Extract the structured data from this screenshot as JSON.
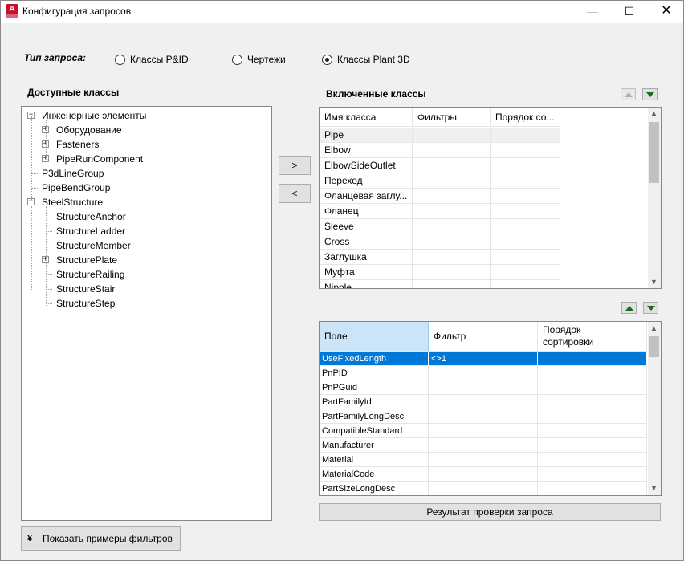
{
  "window": {
    "title": "Конфигурация запросов"
  },
  "query_type": {
    "label": "Тип запроса:",
    "options": [
      {
        "label": "Классы P&ID",
        "selected": false
      },
      {
        "label": "Чертежи",
        "selected": false
      },
      {
        "label": "Классы Plant 3D",
        "selected": true
      }
    ]
  },
  "available": {
    "label": "Доступные классы",
    "tree": [
      {
        "label": "Инженерные элементы",
        "expander": "-"
      },
      {
        "label": "Оборудование",
        "expander": "+"
      },
      {
        "label": "Fasteners",
        "expander": "+"
      },
      {
        "label": "PipeRunComponent",
        "expander": "+"
      },
      {
        "label": "P3dLineGroup",
        "expander": ""
      },
      {
        "label": "PipeBendGroup",
        "expander": ""
      },
      {
        "label": "SteelStructure",
        "expander": "-"
      },
      {
        "label": "StructureAnchor",
        "expander": ""
      },
      {
        "label": "StructureLadder",
        "expander": ""
      },
      {
        "label": "StructureMember",
        "expander": ""
      },
      {
        "label": "StructurePlate",
        "expander": "+"
      },
      {
        "label": "StructureRailing",
        "expander": ""
      },
      {
        "label": "StructureStair",
        "expander": ""
      },
      {
        "label": "StructureStep",
        "expander": ""
      }
    ]
  },
  "move": {
    "add_label": ">",
    "remove_label": "<"
  },
  "included": {
    "label": "Включенные классы",
    "columns": [
      "Имя класса",
      "Фильтры",
      "Порядок со..."
    ],
    "rows": [
      "Pipe",
      "Elbow",
      "ElbowSideOutlet",
      "Переход",
      "Фланцевая заглу...",
      "Фланец",
      "Sleeve",
      "Cross",
      "Заглушка",
      "Муфта",
      "Nipple"
    ]
  },
  "properties": {
    "columns": [
      "Поле",
      "Фильтр",
      "Порядок сортировки"
    ],
    "rows": [
      {
        "field": "UseFixedLength",
        "filter": "<>1",
        "order": ""
      },
      {
        "field": "PnPID",
        "filter": "",
        "order": ""
      },
      {
        "field": "PnPGuid",
        "filter": "",
        "order": ""
      },
      {
        "field": "PartFamilyId",
        "filter": "",
        "order": ""
      },
      {
        "field": "PartFamilyLongDesc",
        "filter": "",
        "order": ""
      },
      {
        "field": "CompatibleStandard",
        "filter": "",
        "order": ""
      },
      {
        "field": "Manufacturer",
        "filter": "",
        "order": ""
      },
      {
        "field": "Material",
        "filter": "",
        "order": ""
      },
      {
        "field": "MaterialCode",
        "filter": "",
        "order": ""
      },
      {
        "field": "PartSizeLongDesc",
        "filter": "",
        "order": ""
      }
    ]
  },
  "test_button": {
    "label": "Результат проверки запроса"
  },
  "examples_button": {
    "label": "Показать примеры фильтров"
  },
  "colors": {
    "selection": "#0078d7",
    "header_selected": "#cce4f7",
    "arrow_green": "#1a6b1a",
    "app_red": "#c8102e"
  }
}
